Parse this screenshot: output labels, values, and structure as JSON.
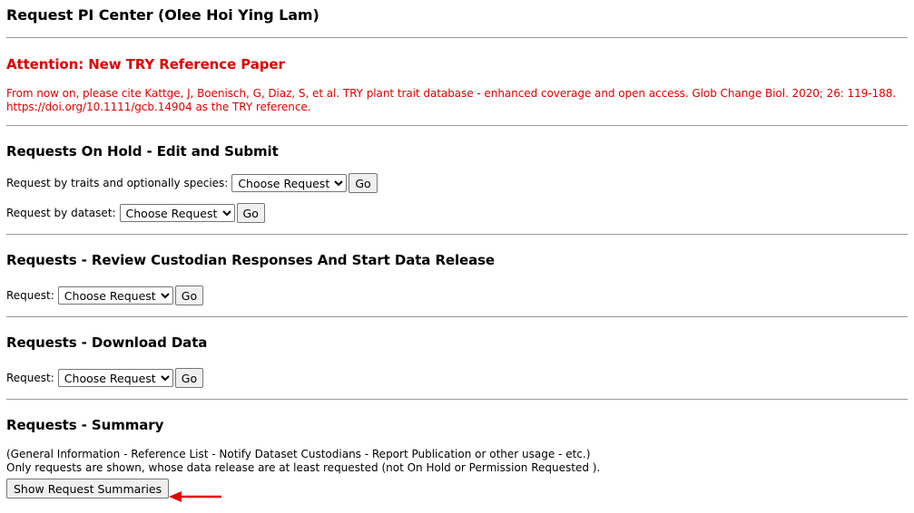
{
  "title": "Request PI Center (Olee Hoi Ying Lam)",
  "attention": {
    "heading": "Attention: New TRY Reference Paper",
    "text": "From now on, please cite Kattge, J, Boenisch, G, Diaz, S, et al. TRY plant trait database - enhanced coverage and open access. Glob Change Biol. 2020; 26: 119-188. https://doi.org/10.1111/gcb.14904 as the TRY reference.",
    "color": "#e00000"
  },
  "on_hold": {
    "heading": "Requests On Hold - Edit and Submit",
    "traits_label": "Request by traits and optionally species:",
    "traits_select": "Choose Request",
    "dataset_label": "Request by dataset:",
    "dataset_select": "Choose Request",
    "go": "Go"
  },
  "review": {
    "heading": "Requests - Review Custodian Responses And Start Data Release",
    "label": "Request:",
    "select": "Choose Request",
    "go": "Go"
  },
  "download": {
    "heading": "Requests - Download Data",
    "label": "Request:",
    "select": "Choose Request",
    "go": "Go"
  },
  "summary": {
    "heading": "Requests - Summary",
    "line1": "(General Information - Reference List - Notify Dataset Custodians - Report Publication or other usage - etc.)",
    "line2": "Only requests are shown, whose data release are at least requested (not On Hold or Permission Requested ).",
    "button": "Show Request Summaries"
  }
}
